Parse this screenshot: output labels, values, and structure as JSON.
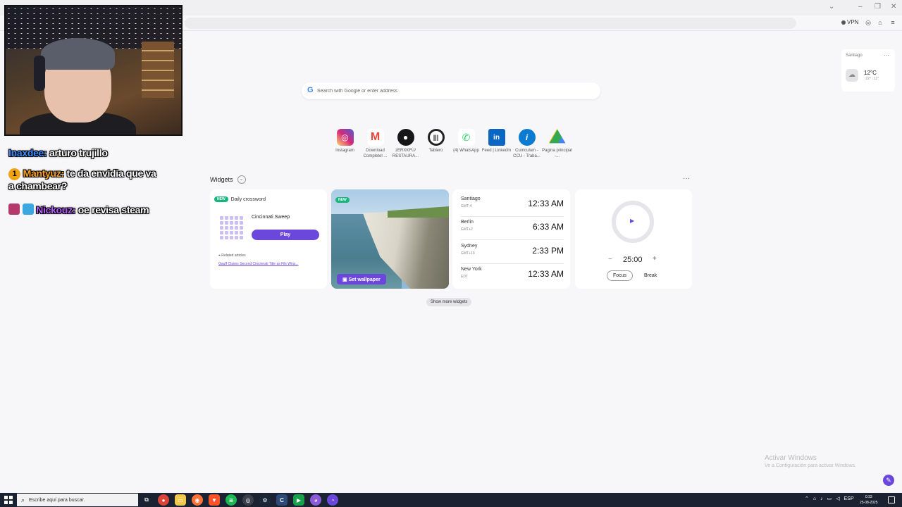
{
  "browser": {
    "vpn_label": "VPN"
  },
  "chat": {
    "messages": [
      {
        "user": "Inaxdee:",
        "text": "arturo trujillo"
      },
      {
        "user": "Mantyuz:",
        "text": "te da envidia que va",
        "text2": "a chambear?",
        "badge": "1"
      },
      {
        "user": "Nickouz:",
        "text": "oe revisa steam"
      }
    ]
  },
  "search": {
    "placeholder": "Search with Google or enter address"
  },
  "speed_dials": [
    {
      "label": "Instagram",
      "icon": "instagram-icon",
      "color": "#d62976"
    },
    {
      "label": "Download Completel ...",
      "icon": "gmail-icon",
      "color": "#ffffff"
    },
    {
      "label": "zERXKFU/ RESTAURA...",
      "icon": "github-icon",
      "color": "#181717"
    },
    {
      "label": "Tablero",
      "icon": "tablero-icon",
      "color": "#ffffff"
    },
    {
      "label": "(4) WhatsApp",
      "icon": "whatsapp-icon",
      "color": "#25d366"
    },
    {
      "label": "Feed | LinkedIn",
      "icon": "linkedin-icon",
      "color": "#0a66c2"
    },
    {
      "label": "Curriculum - CCU - Traba...",
      "icon": "ccu-icon",
      "color": "#0b7ad1"
    },
    {
      "label": "Pagina principal -...",
      "icon": "drive-icon",
      "color": "#ffffff"
    }
  ],
  "weather": {
    "city": "Santiago",
    "temp": "12°C",
    "hilo": "↑22° ↓11°"
  },
  "widgets": {
    "title": "Widgets",
    "new_label": "NEW",
    "crossword": {
      "header": "Daily crossword",
      "game": "Cincinnati Sweep",
      "play": "Play",
      "related": "Related articles",
      "article": "Gauff Claims Second Cincinnati Title as Fils Wins..."
    },
    "wallpaper": {
      "button": "Set wallpaper"
    },
    "clocks": [
      {
        "city": "Santiago",
        "tz": "GMT-4",
        "time": "12:33 AM"
      },
      {
        "city": "Berlin",
        "tz": "GMT+2",
        "time": "6:33 AM"
      },
      {
        "city": "Sydney",
        "tz": "GMT+10",
        "time": "2:33 PM"
      },
      {
        "city": "New York",
        "tz": "EDT",
        "time": "12:33 AM"
      }
    ],
    "pomodoro": {
      "duration": "25:00",
      "focus": "Focus",
      "break": "Break"
    },
    "show_more": "Show more widgets"
  },
  "activate_windows": {
    "line1": "Activar Windows",
    "line2": "Ve a Configuración para activar Windows."
  },
  "taskbar": {
    "search_placeholder": "Escribe aquí para buscar.",
    "lang": "ESP",
    "time": "0:33",
    "date": "25-08-2025"
  }
}
